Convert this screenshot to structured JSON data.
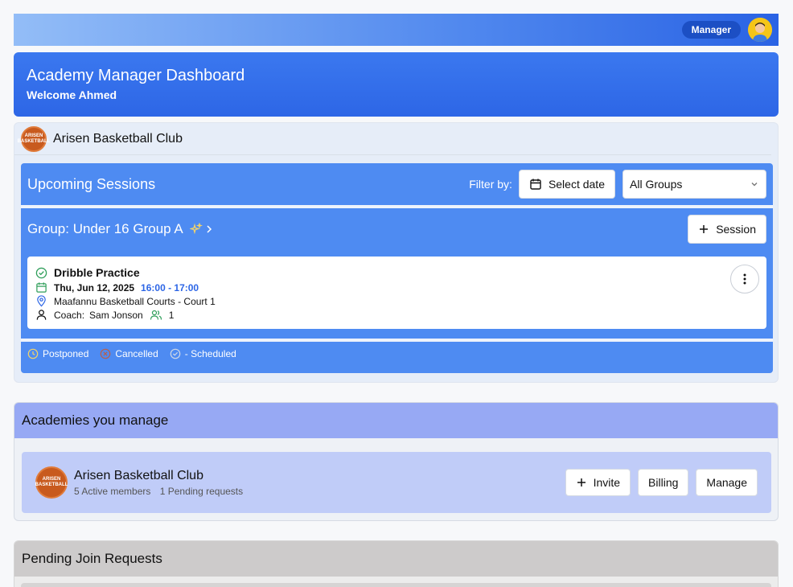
{
  "topbar": {
    "role": "Manager"
  },
  "hero": {
    "title": "Academy Manager Dashboard",
    "welcome": "Welcome Ahmed"
  },
  "club": {
    "name": "Arisen Basketball Club",
    "logo_text": "ARISEN BASKETBALL"
  },
  "sessions": {
    "title": "Upcoming Sessions",
    "filter_label": "Filter by:",
    "select_date": "Select date",
    "groups_select": "All Groups",
    "group": {
      "title": "Group: Under 16 Group A",
      "add_session": "Session",
      "items": [
        {
          "title": "Dribble Practice",
          "date": "Thu, Jun 12, 2025",
          "time": "16:00 - 17:00",
          "location": "Maafannu Basketball Courts - Court 1",
          "coach_label": "Coach:",
          "coach": "Sam Jonson",
          "attendees": "1"
        }
      ]
    },
    "legend": {
      "postponed": "Postponed",
      "cancelled": "Cancelled",
      "scheduled": "- Scheduled"
    }
  },
  "academies": {
    "title": "Academies you manage",
    "items": [
      {
        "name": "Arisen Basketball Club",
        "active": "5 Active members",
        "pending": "1 Pending requests",
        "invite": "Invite",
        "billing": "Billing",
        "manage": "Manage"
      }
    ]
  },
  "pending": {
    "title": "Pending Join Requests"
  },
  "colors": {
    "accent": "#2d66e6",
    "session_panel": "#4e8bf2",
    "academies_header": "#97a9f4"
  }
}
